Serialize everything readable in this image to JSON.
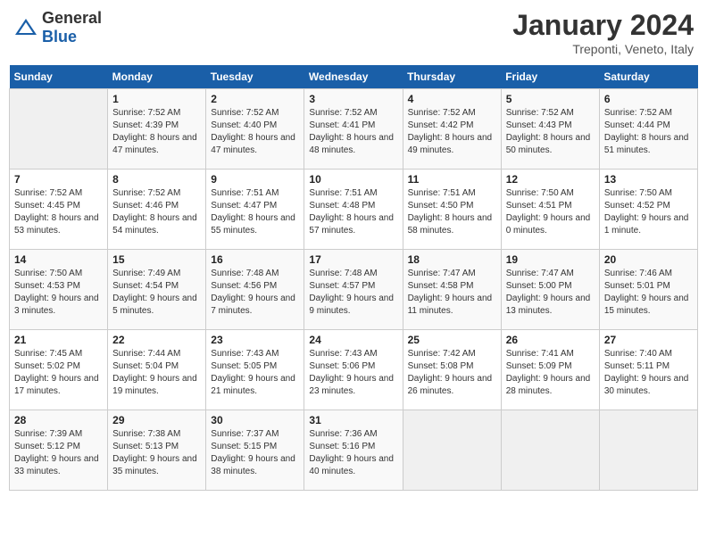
{
  "header": {
    "logo_general": "General",
    "logo_blue": "Blue",
    "title": "January 2024",
    "subtitle": "Treponti, Veneto, Italy"
  },
  "days_of_week": [
    "Sunday",
    "Monday",
    "Tuesday",
    "Wednesday",
    "Thursday",
    "Friday",
    "Saturday"
  ],
  "weeks": [
    [
      {
        "day": "",
        "sunrise": "",
        "sunset": "",
        "daylight": ""
      },
      {
        "day": "1",
        "sunrise": "7:52 AM",
        "sunset": "4:39 PM",
        "daylight": "8 hours and 47 minutes."
      },
      {
        "day": "2",
        "sunrise": "7:52 AM",
        "sunset": "4:40 PM",
        "daylight": "8 hours and 47 minutes."
      },
      {
        "day": "3",
        "sunrise": "7:52 AM",
        "sunset": "4:41 PM",
        "daylight": "8 hours and 48 minutes."
      },
      {
        "day": "4",
        "sunrise": "7:52 AM",
        "sunset": "4:42 PM",
        "daylight": "8 hours and 49 minutes."
      },
      {
        "day": "5",
        "sunrise": "7:52 AM",
        "sunset": "4:43 PM",
        "daylight": "8 hours and 50 minutes."
      },
      {
        "day": "6",
        "sunrise": "7:52 AM",
        "sunset": "4:44 PM",
        "daylight": "8 hours and 51 minutes."
      }
    ],
    [
      {
        "day": "7",
        "sunrise": "7:52 AM",
        "sunset": "4:45 PM",
        "daylight": "8 hours and 53 minutes."
      },
      {
        "day": "8",
        "sunrise": "7:52 AM",
        "sunset": "4:46 PM",
        "daylight": "8 hours and 54 minutes."
      },
      {
        "day": "9",
        "sunrise": "7:51 AM",
        "sunset": "4:47 PM",
        "daylight": "8 hours and 55 minutes."
      },
      {
        "day": "10",
        "sunrise": "7:51 AM",
        "sunset": "4:48 PM",
        "daylight": "8 hours and 57 minutes."
      },
      {
        "day": "11",
        "sunrise": "7:51 AM",
        "sunset": "4:50 PM",
        "daylight": "8 hours and 58 minutes."
      },
      {
        "day": "12",
        "sunrise": "7:50 AM",
        "sunset": "4:51 PM",
        "daylight": "9 hours and 0 minutes."
      },
      {
        "day": "13",
        "sunrise": "7:50 AM",
        "sunset": "4:52 PM",
        "daylight": "9 hours and 1 minute."
      }
    ],
    [
      {
        "day": "14",
        "sunrise": "7:50 AM",
        "sunset": "4:53 PM",
        "daylight": "9 hours and 3 minutes."
      },
      {
        "day": "15",
        "sunrise": "7:49 AM",
        "sunset": "4:54 PM",
        "daylight": "9 hours and 5 minutes."
      },
      {
        "day": "16",
        "sunrise": "7:48 AM",
        "sunset": "4:56 PM",
        "daylight": "9 hours and 7 minutes."
      },
      {
        "day": "17",
        "sunrise": "7:48 AM",
        "sunset": "4:57 PM",
        "daylight": "9 hours and 9 minutes."
      },
      {
        "day": "18",
        "sunrise": "7:47 AM",
        "sunset": "4:58 PM",
        "daylight": "9 hours and 11 minutes."
      },
      {
        "day": "19",
        "sunrise": "7:47 AM",
        "sunset": "5:00 PM",
        "daylight": "9 hours and 13 minutes."
      },
      {
        "day": "20",
        "sunrise": "7:46 AM",
        "sunset": "5:01 PM",
        "daylight": "9 hours and 15 minutes."
      }
    ],
    [
      {
        "day": "21",
        "sunrise": "7:45 AM",
        "sunset": "5:02 PM",
        "daylight": "9 hours and 17 minutes."
      },
      {
        "day": "22",
        "sunrise": "7:44 AM",
        "sunset": "5:04 PM",
        "daylight": "9 hours and 19 minutes."
      },
      {
        "day": "23",
        "sunrise": "7:43 AM",
        "sunset": "5:05 PM",
        "daylight": "9 hours and 21 minutes."
      },
      {
        "day": "24",
        "sunrise": "7:43 AM",
        "sunset": "5:06 PM",
        "daylight": "9 hours and 23 minutes."
      },
      {
        "day": "25",
        "sunrise": "7:42 AM",
        "sunset": "5:08 PM",
        "daylight": "9 hours and 26 minutes."
      },
      {
        "day": "26",
        "sunrise": "7:41 AM",
        "sunset": "5:09 PM",
        "daylight": "9 hours and 28 minutes."
      },
      {
        "day": "27",
        "sunrise": "7:40 AM",
        "sunset": "5:11 PM",
        "daylight": "9 hours and 30 minutes."
      }
    ],
    [
      {
        "day": "28",
        "sunrise": "7:39 AM",
        "sunset": "5:12 PM",
        "daylight": "9 hours and 33 minutes."
      },
      {
        "day": "29",
        "sunrise": "7:38 AM",
        "sunset": "5:13 PM",
        "daylight": "9 hours and 35 minutes."
      },
      {
        "day": "30",
        "sunrise": "7:37 AM",
        "sunset": "5:15 PM",
        "daylight": "9 hours and 38 minutes."
      },
      {
        "day": "31",
        "sunrise": "7:36 AM",
        "sunset": "5:16 PM",
        "daylight": "9 hours and 40 minutes."
      },
      {
        "day": "",
        "sunrise": "",
        "sunset": "",
        "daylight": ""
      },
      {
        "day": "",
        "sunrise": "",
        "sunset": "",
        "daylight": ""
      },
      {
        "day": "",
        "sunrise": "",
        "sunset": "",
        "daylight": ""
      }
    ]
  ],
  "labels": {
    "sunrise_prefix": "Sunrise: ",
    "sunset_prefix": "Sunset: ",
    "daylight_prefix": "Daylight: "
  }
}
